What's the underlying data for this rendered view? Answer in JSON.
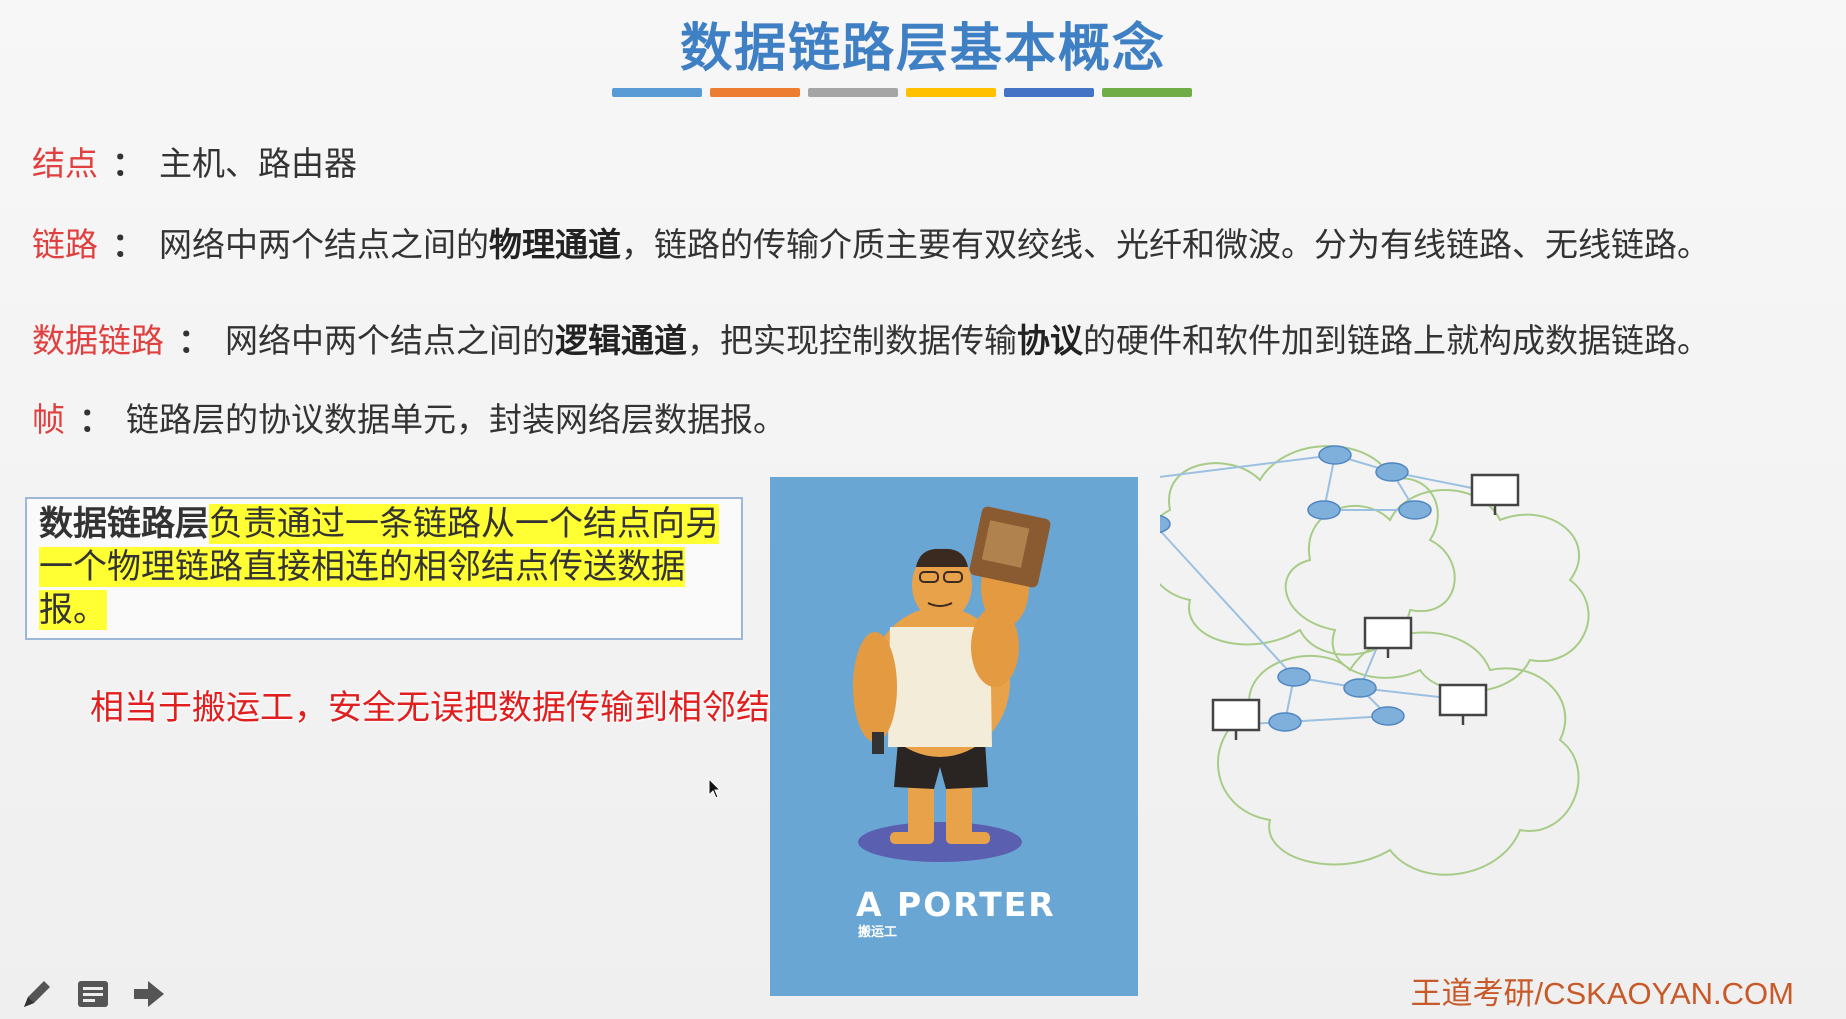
{
  "slide": {
    "title": "数据链路层基本概念",
    "title_bar_colors": [
      "#5b9bd5",
      "#ed7d31",
      "#a5a5a5",
      "#ffc000",
      "#4472c4",
      "#70ad47"
    ]
  },
  "definitions": [
    {
      "term": "结点",
      "colon": "：",
      "text": "主机、路由器"
    },
    {
      "term": "链路",
      "colon": "：",
      "pre": "网络中两个结点之间的",
      "bold": "物理通道",
      "post": "，链路的传输介质主要有双绞线、光纤和微波。分为有线链路、无线链路。"
    },
    {
      "term": "数据链路",
      "colon": "：",
      "pre": "网络中两个结点之间的",
      "bold": "逻辑通道",
      "mid": "，把实现控制数据传输",
      "bold2": "协议",
      "post": "的硬件和软件加到链路上就构成数据链路。"
    },
    {
      "term": "帧",
      "colon": "：",
      "text": "链路层的协议数据单元，封装网络层数据报。"
    }
  ],
  "summary_box": {
    "term": "数据链路层",
    "highlighted": "负责通过一条链路从一个结点向另一个物理链路直接相连的相邻结点传送数据报。"
  },
  "annotation": "相当于搬运工，安全无误把数据传输到相邻结点",
  "poster": {
    "title": "A PORTER",
    "subtitle": "搬运工",
    "background": "#6aa6d4"
  },
  "toolbar": {
    "icons": [
      "pen-icon",
      "notes-icon",
      "arrow-right-icon"
    ]
  },
  "watermark": "王道考研/CSKAOYAN.COM",
  "colors": {
    "title": "#3f7fc4",
    "term": "#e04040",
    "highlight": "#ffff33",
    "annotation": "#e02020"
  }
}
